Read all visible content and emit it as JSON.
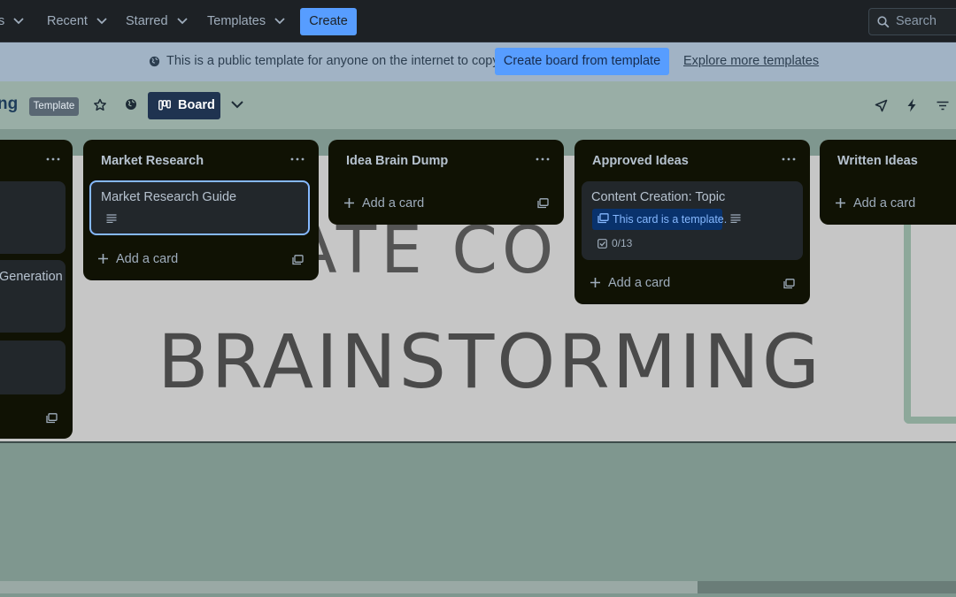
{
  "topnav": {
    "partial_item": "s",
    "recent": "Recent",
    "starred": "Starred",
    "templates": "Templates",
    "create": "Create",
    "search_placeholder": "Search"
  },
  "banner": {
    "message": "This is a public template for anyone on the internet to copy.",
    "create_button": "Create board from template",
    "explore_link": "Explore more templates"
  },
  "board_header": {
    "title_partial": "ng",
    "badge": "Template",
    "view": "Board"
  },
  "background": {
    "line1": "ATE CO",
    "line2": "BRAINSTORMING"
  },
  "lists": [
    {
      "title": "",
      "cards": [
        {
          "title": ""
        },
        {
          "title": "Generation"
        },
        {
          "title": ""
        }
      ]
    },
    {
      "title": "Market Research",
      "cards": [
        {
          "title": "Market Research Guide"
        }
      ],
      "add_card": "Add a card"
    },
    {
      "title": "Idea Brain Dump",
      "cards": [],
      "add_card": "Add a card"
    },
    {
      "title": "Approved Ideas",
      "cards": [
        {
          "title": "Content Creation: Topic",
          "template_badge": "This card is a template.",
          "checklist": "0/13"
        }
      ],
      "add_card": "Add a card"
    },
    {
      "title": "Written Ideas",
      "cards": [],
      "add_card": "Add a card"
    }
  ],
  "scrollbar": {
    "position_fraction": 0.0,
    "visible_fraction": 0.73
  },
  "icons": [
    "chevron-down-icon",
    "search-icon",
    "globe-icon",
    "star-icon",
    "board-icon",
    "megaphone-icon",
    "lightning-icon",
    "filter-icon",
    "more-icon",
    "plus-icon",
    "template-icon",
    "description-icon",
    "checklist-icon"
  ]
}
